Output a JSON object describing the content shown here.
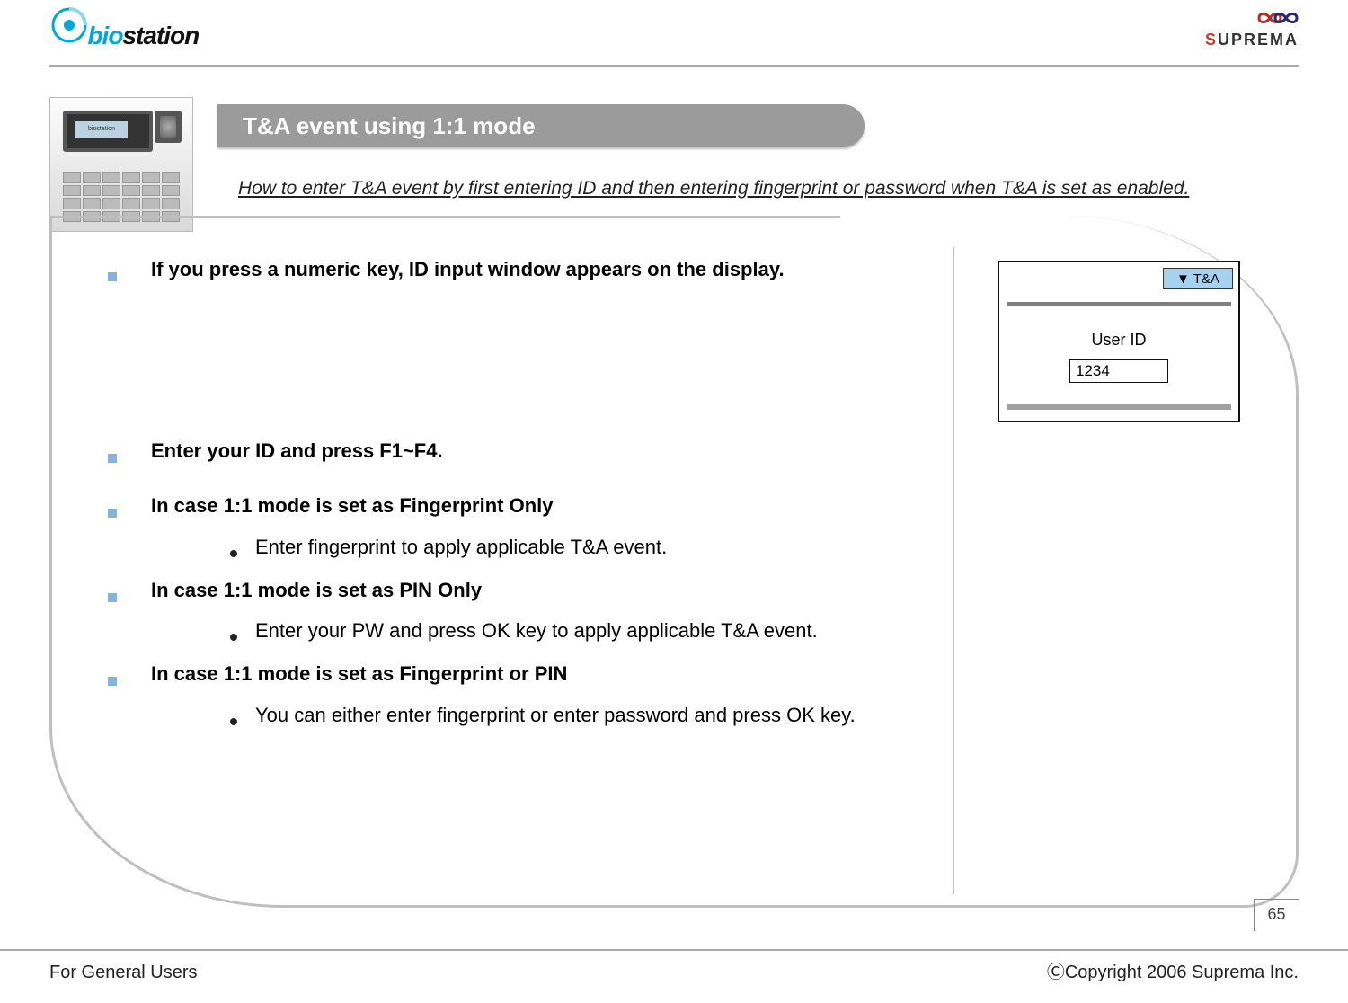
{
  "header": {
    "product_logo_text": "biostation",
    "company_logo_text": "SUPREMA"
  },
  "title": "T&A event using 1:1 mode",
  "intro": "How to enter T&A event by first entering ID and then entering fingerprint or password when T&A is set as enabled.",
  "body": {
    "b1": "If you press a numeric key, ID input window appears on the display.",
    "b2": "Enter your ID and press F1~F4.",
    "b3": "In case 1:1 mode is set as Fingerprint Only",
    "b3_sub1": "Enter fingerprint to apply applicable T&A event.",
    "b4": "In case 1:1 mode is set as PIN Only",
    "b4_sub1": "Enter your PW and press OK key to apply applicable T&A event.",
    "b5": "In case 1:1 mode is set as Fingerprint or PIN",
    "b5_sub1": "You can either enter fingerprint or enter password and press OK key."
  },
  "lcd": {
    "tab": "▼ T&A",
    "user_label": "User ID",
    "user_value": "1234"
  },
  "footer": {
    "page": "65",
    "left": "For General Users",
    "right": "ⒸCopyright 2006 Suprema Inc."
  }
}
